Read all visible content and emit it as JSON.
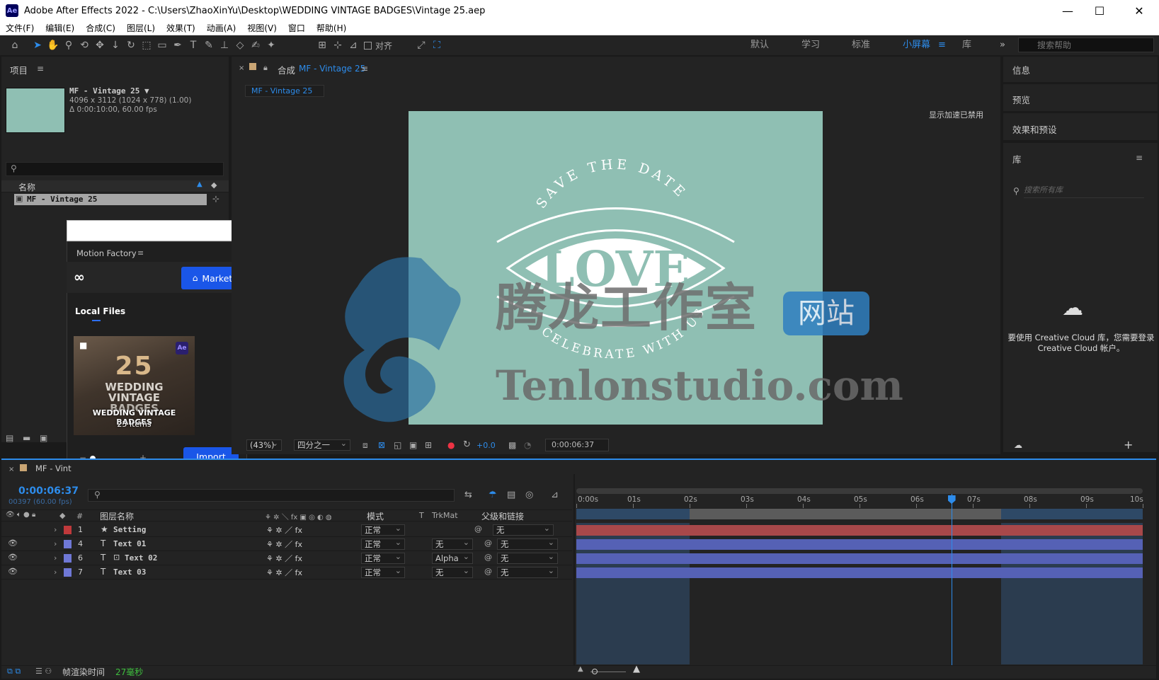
{
  "window": {
    "app_icon": "Ae",
    "title": "Adobe After Effects 2022 - C:\\Users\\ZhaoXinYu\\Desktop\\WEDDING VINTAGE BADGES\\Vintage 25.aep",
    "min": "—",
    "max": "☐",
    "close": "✕"
  },
  "menu": [
    "文件(F)",
    "编辑(E)",
    "合成(C)",
    "图层(L)",
    "效果(T)",
    "动画(A)",
    "视图(V)",
    "窗口",
    "帮助(H)"
  ],
  "toolbar": {
    "align_label": "对齐",
    "workspaces": [
      "默认",
      "学习",
      "标准",
      "小屏幕",
      "库"
    ],
    "more": "»",
    "search_placeholder": "搜索帮助"
  },
  "project": {
    "title": "项目",
    "item_name": "MF - Vintage 25 ▼",
    "item_info1": "4096 x 3112 (1024 x 778) (1.00)",
    "item_info2": "Δ 0:00:10:00, 60.00 fps",
    "col_name": "名称",
    "row_name": "MF - Vintage 25",
    "thumb_color": "#8fbfb3"
  },
  "motion_factory": {
    "title": "Motion Factory",
    "market": "Market",
    "local_files": "Local Files",
    "card_title": "WEDDING VINTAGE BADGES",
    "card_count": "25 Items",
    "card_number": "25",
    "card_art_line1": "WEDDING",
    "card_art_line2": "VINTAGE",
    "card_art_line3": "BADGES",
    "card_badge": "Ae",
    "slider_minus": "−",
    "slider_plus": "+",
    "slider_value": 0.1,
    "import": "Import"
  },
  "comp": {
    "tab_prefix": "合成",
    "tab_name": "MF - Vintage 25",
    "chip": "MF - Vintage 25",
    "accel_notice": "显示加速已禁用",
    "bg_color": "#8fbfb3",
    "badge_top": "SAVE THE DATE",
    "badge_main": "LOVE",
    "badge_bottom": "CELEBRATE WITH US",
    "zoom": "(43%)",
    "resolution": "四分之一",
    "exposure": "+0.0",
    "timecode": "0:00:06:37",
    "watermark_cn": "腾龙工作室",
    "watermark_site": "网站",
    "watermark_url": "Tenlonstudio.com"
  },
  "right_panels": {
    "info": "信息",
    "preview": "预览",
    "effects": "效果和预设",
    "library": "库",
    "lib_search": "搜索所有库",
    "cc_msg": "要使用 Creative Cloud 库，您需要登录 Creative Cloud 帐户。"
  },
  "timeline": {
    "tab": "MF - Vint",
    "timecode": "0:00:06:37",
    "frames": "00397 (60.00 fps)",
    "cols": {
      "num": "#",
      "name": "图层名称",
      "mode": "模式",
      "t": "T",
      "trkmat": "TrkMat",
      "parent": "父级和链接"
    },
    "layers": [
      {
        "num": "1",
        "type": "★",
        "name": "Setting",
        "mode": "正常",
        "trk": "",
        "parent": "无",
        "label": "#c0393b",
        "bar": "#a8484a",
        "eye": ""
      },
      {
        "num": "4",
        "type": "T",
        "name": "Text 01",
        "mode": "正常",
        "trk": "无",
        "parent": "无",
        "label": "#6f78d6",
        "bar": "#5561b5",
        "eye": "👁"
      },
      {
        "num": "6",
        "type": "T",
        "name": "Text 02",
        "mode": "正常",
        "trk": "Alpha",
        "parent": "无",
        "label": "#6f78d6",
        "bar": "#5561b5",
        "eye": "👁"
      },
      {
        "num": "7",
        "type": "T",
        "name": "Text 03",
        "mode": "正常",
        "trk": "无",
        "parent": "无",
        "label": "#6f78d6",
        "bar": "#5561b5",
        "eye": "👁"
      }
    ],
    "ruler": [
      "0:00s",
      "01s",
      "02s",
      "03s",
      "04s",
      "05s",
      "06s",
      "07s",
      "08s",
      "09s",
      "10s"
    ],
    "playhead_seconds": 6.62,
    "work_area_seconds": [
      2.0,
      7.5
    ],
    "footer_label": "帧渲染时间",
    "footer_value": "27毫秒"
  }
}
